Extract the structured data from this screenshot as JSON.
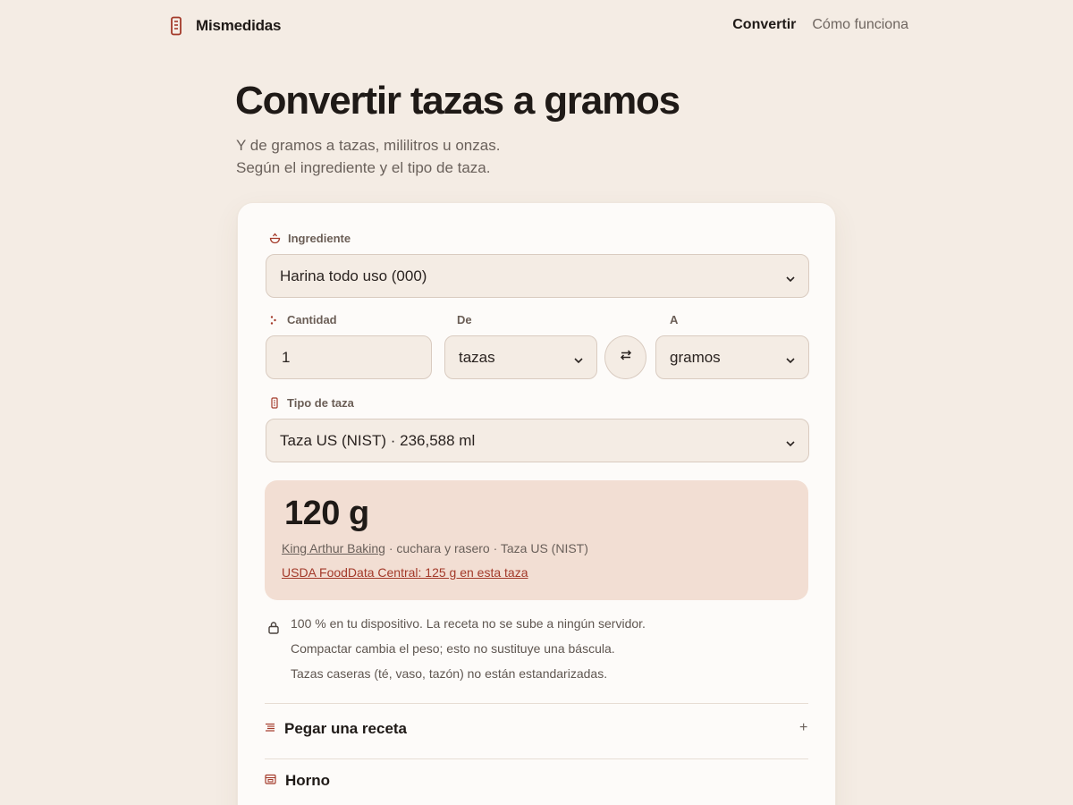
{
  "header": {
    "brand": "Mismedidas",
    "nav": [
      {
        "label": "Convertir",
        "active": true
      },
      {
        "label": "Cómo funciona",
        "active": false
      }
    ]
  },
  "hero": {
    "title": "Convertir tazas a gramos",
    "subtitle_line1": "Y de gramos a tazas, mililitros u onzas.",
    "subtitle_line2": "Según el ingrediente y el tipo de taza."
  },
  "form": {
    "ingredient_label": "Ingrediente",
    "ingredient_value": "Harina todo uso (000)",
    "quantity_label": "Cantidad",
    "quantity_value": "1",
    "from_label": "De",
    "from_value": "tazas",
    "to_label": "A",
    "to_value": "gramos",
    "cup_type_label": "Tipo de taza",
    "cup_type_value": "Taza US (NIST) · 236,588 ml"
  },
  "result": {
    "value": "120 g",
    "source_link": "King Arthur Baking",
    "source_rest": " · cuchara y rasero · Taza US (NIST)",
    "usda_link": "USDA FoodData Central: 125 g en esta taza"
  },
  "notes": [
    "100 % en tu dispositivo. La receta no se sube a ningún servidor.",
    "Compactar cambia el peso; esto no sustituye una báscula.",
    "Tazas caseras (té, vaso, tazón) no están estandarizadas."
  ],
  "sections": {
    "paste_recipe": "Pegar una receta",
    "expand_symbol": "+",
    "oven": "Horno"
  },
  "colors": {
    "background": "#f4ece4",
    "card": "#fdfbf9",
    "accent": "#a33a2a",
    "result_bg": "#f2ded3"
  }
}
